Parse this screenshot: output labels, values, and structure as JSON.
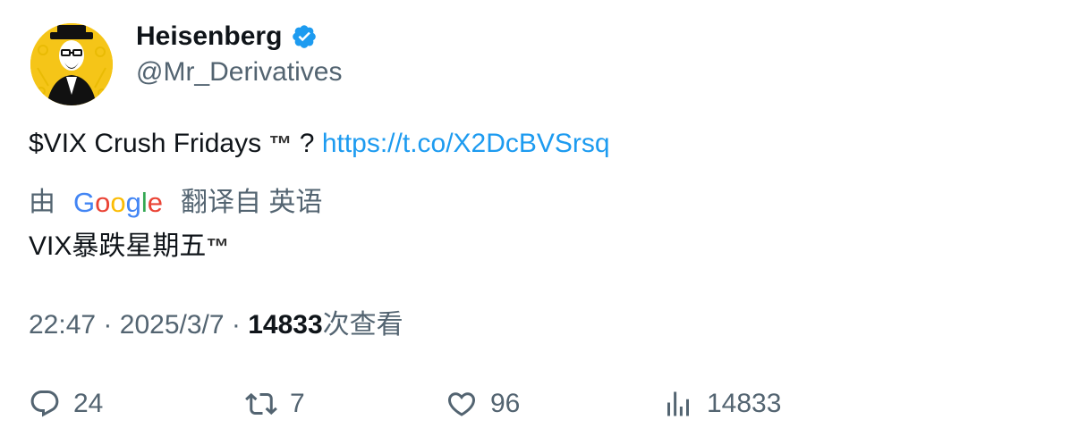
{
  "author": {
    "display_name": "Heisenberg",
    "handle": "@Mr_Derivatives",
    "verified": true,
    "avatar_icon": "heisenberg-avatar-icon"
  },
  "tweet": {
    "text": "$VIX Crush Fridays",
    "tm": "™",
    "question_mark": "?",
    "link_text": "https://t.co/X2DcBVSrsq"
  },
  "translation": {
    "by_label": "由",
    "provider_logo": "Google",
    "translated_from_label": "翻译自 英语",
    "translated_text": "VIX暴跌星期五",
    "tm": "™"
  },
  "meta": {
    "time": "22:47",
    "separator": "·",
    "date": "2025/3/7",
    "views_count": "14833",
    "views_label": "次查看"
  },
  "actions": {
    "replies": "24",
    "retweets": "7",
    "likes": "96",
    "views": "14833"
  },
  "colors": {
    "link": "#1d9bf0",
    "secondary_text": "#536471",
    "verified_badge": "#1d9bf0",
    "avatar_bg": "#f5c518"
  }
}
